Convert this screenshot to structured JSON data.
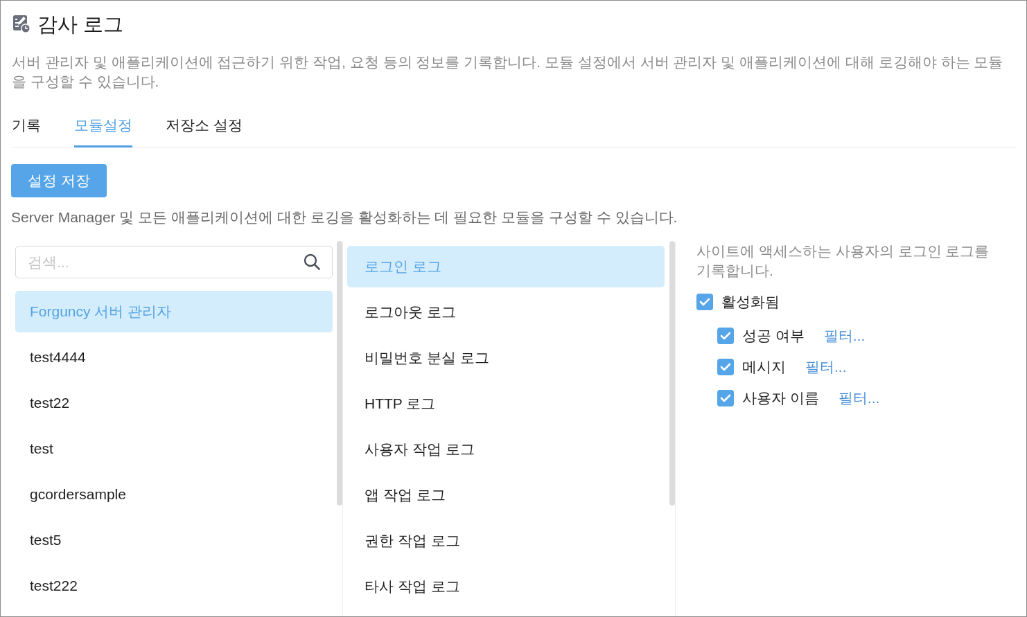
{
  "page": {
    "title": "감사 로그",
    "description": "서버 관리자 및 애플리케이션에 접근하기 위한 작업, 요청 등의 정보를 기록합니다. 모듈 설정에서 서버 관리자 및 애플리케이션에 대해 로깅해야 하는 모듈을 구성할 수 있습니다."
  },
  "tabs": [
    {
      "label": "기록",
      "selected": false
    },
    {
      "label": "모듈설정",
      "selected": true
    },
    {
      "label": "저장소 설정",
      "selected": false
    }
  ],
  "save_button": {
    "label": "설정 저장"
  },
  "hint": "Server Manager 및 모든 애플리케이션에 대한 로깅을 활성화하는 데 필요한 모듈을 구성할 수 있습니다.",
  "search": {
    "placeholder": "검색..."
  },
  "applications": [
    {
      "label": "Forguncy 서버 관리자",
      "selected": true
    },
    {
      "label": "test4444",
      "selected": false
    },
    {
      "label": "test22",
      "selected": false
    },
    {
      "label": "test",
      "selected": false
    },
    {
      "label": "gcordersample",
      "selected": false
    },
    {
      "label": "test5",
      "selected": false
    },
    {
      "label": "test222",
      "selected": false
    }
  ],
  "modules": [
    {
      "label": "로그인 로그",
      "selected": true
    },
    {
      "label": "로그아웃 로그",
      "selected": false
    },
    {
      "label": "비밀번호 분실 로그",
      "selected": false
    },
    {
      "label": "HTTP 로그",
      "selected": false
    },
    {
      "label": "사용자 작업 로그",
      "selected": false
    },
    {
      "label": "앱 작업 로그",
      "selected": false
    },
    {
      "label": "권한 작업 로그",
      "selected": false
    },
    {
      "label": "타사 작업 로그",
      "selected": false
    }
  ],
  "module_detail": {
    "description": "사이트에 액세스하는 사용자의 로그인 로그를 기록합니다.",
    "enabled": {
      "label": "활성화됨",
      "checked": true
    },
    "fields": [
      {
        "label": "성공 여부",
        "checked": true,
        "filter_link": "필터..."
      },
      {
        "label": "메시지",
        "checked": true,
        "filter_link": "필터..."
      },
      {
        "label": "사용자 이름",
        "checked": true,
        "filter_link": "필터..."
      }
    ]
  }
}
